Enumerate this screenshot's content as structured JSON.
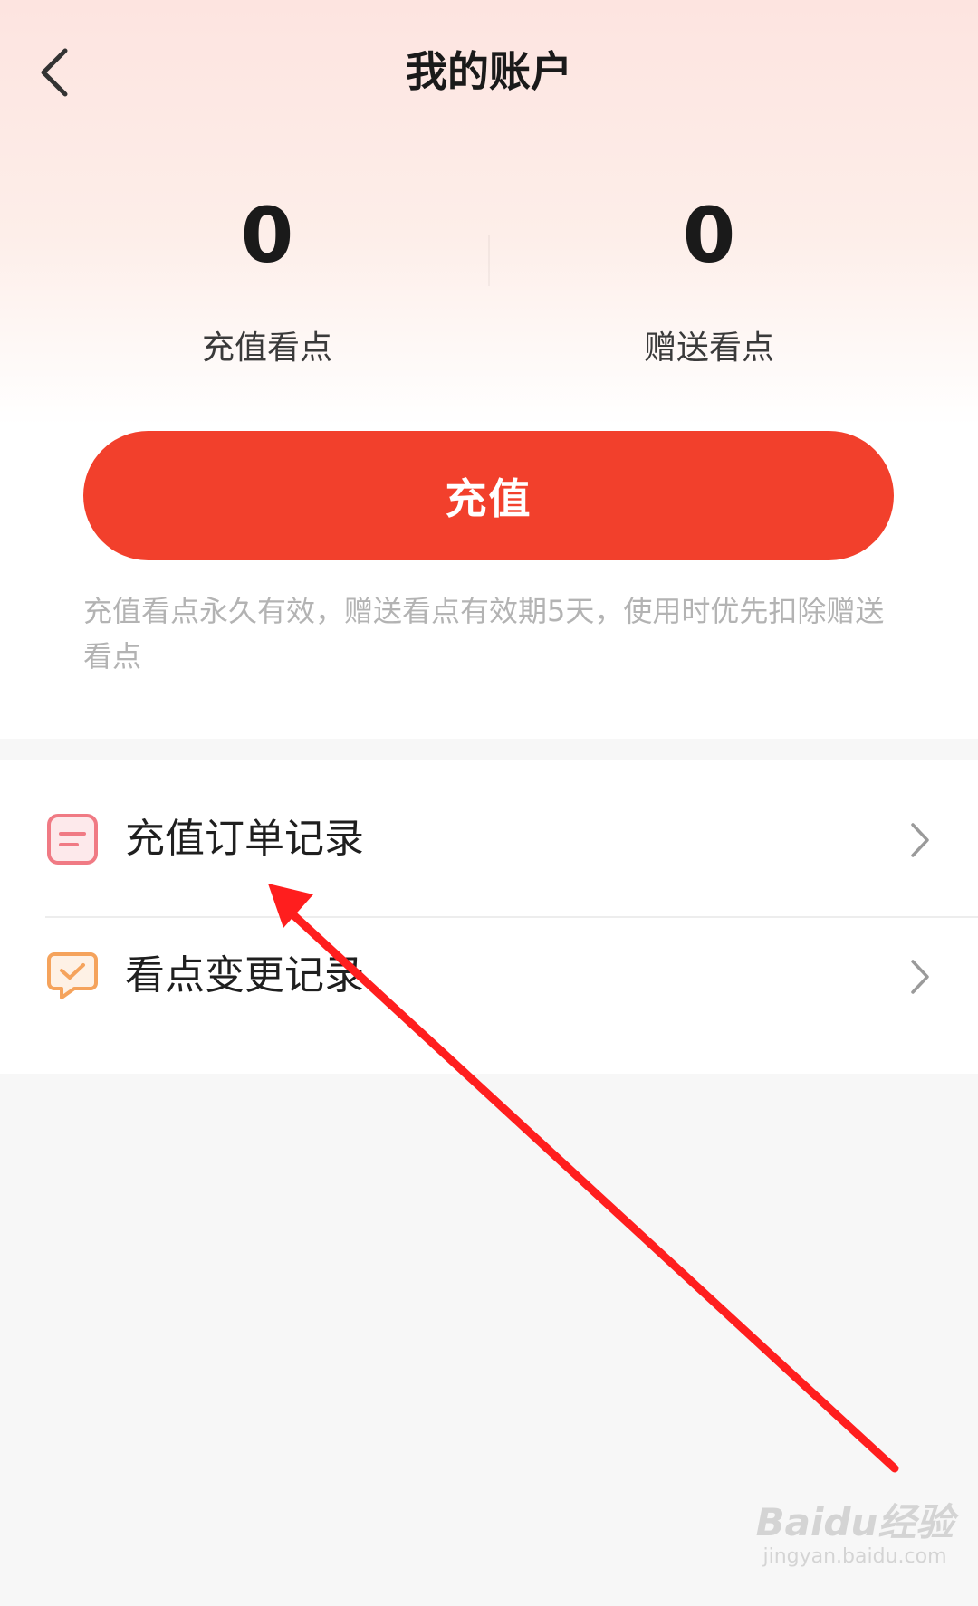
{
  "header": {
    "back_icon": "chevron-left-icon",
    "title": "我的账户"
  },
  "balances": {
    "recharge": {
      "value": "0",
      "label": "充值看点"
    },
    "gift": {
      "value": "0",
      "label": "赠送看点"
    }
  },
  "recharge_button": {
    "label": "充值"
  },
  "notice": "充值看点永久有效，赠送看点有效期5天，使用时优先扣除赠送看点",
  "records": [
    {
      "label": "充值订单记录",
      "icon": "document-list-icon",
      "icon_color": "#f07a84"
    },
    {
      "label": "看点变更记录",
      "icon": "chat-check-icon",
      "icon_color": "#f5a35c"
    }
  ],
  "colors": {
    "accent": "#f2402c",
    "annotation_arrow": "#ff1e1e"
  },
  "watermark": {
    "logo": "Baidu经验",
    "url": "jingyan.baidu.com"
  }
}
